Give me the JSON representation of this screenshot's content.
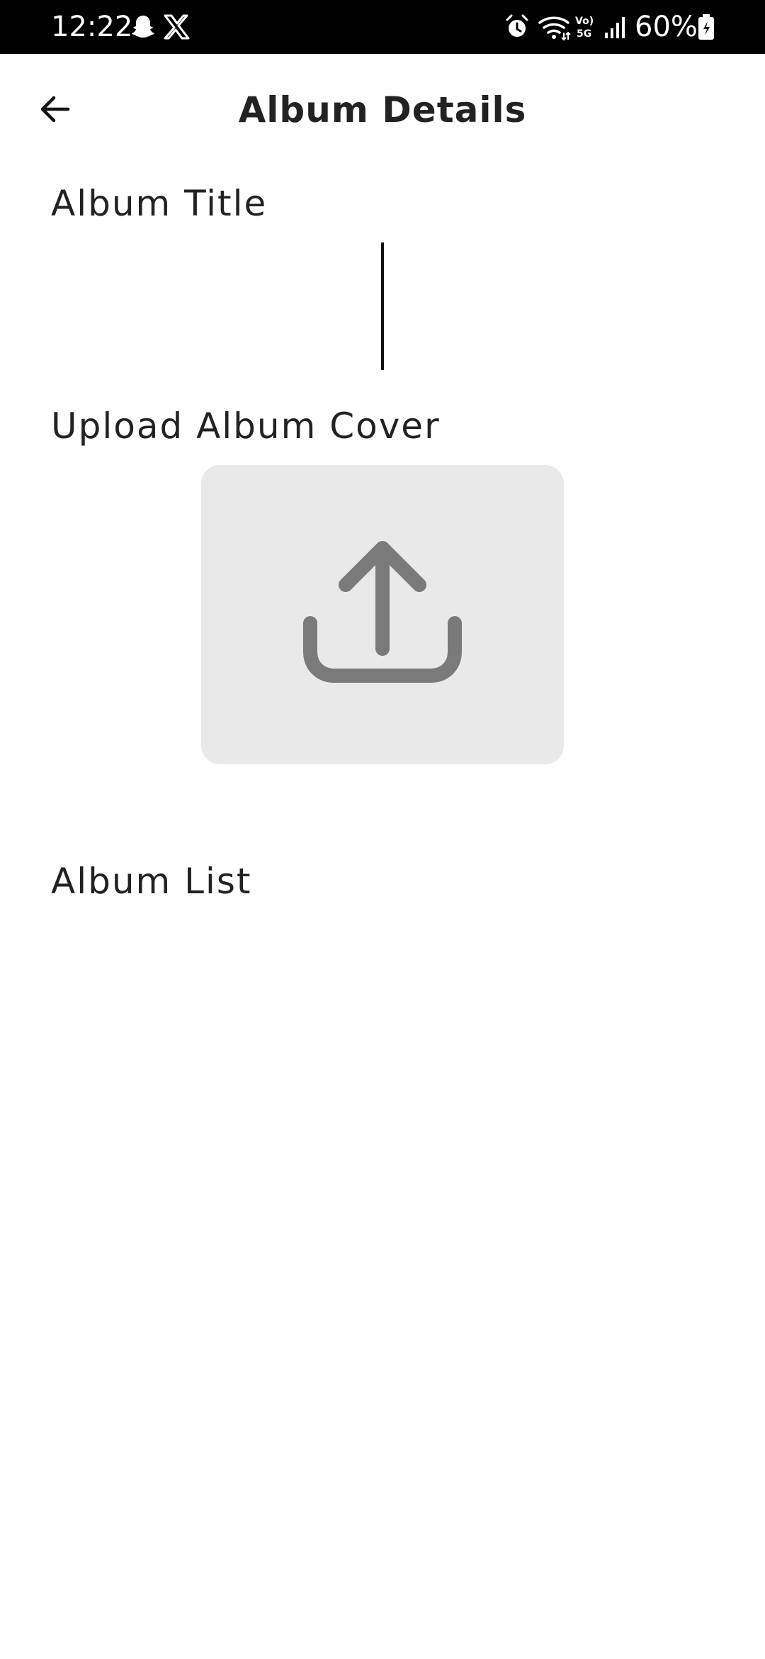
{
  "status_bar": {
    "time": "12:22",
    "battery": "60%",
    "icons": [
      "snapchat-icon",
      "x-icon",
      "alarm-icon",
      "wifi-icon",
      "volte-5g-icon",
      "signal-icon",
      "battery-icon"
    ]
  },
  "header": {
    "title": "Album Details",
    "back_icon": "arrow-left-icon"
  },
  "form": {
    "album_title_label": "Album Title",
    "album_title_value": "",
    "upload_cover_label": "Upload Album Cover",
    "upload_icon": "upload-icon",
    "album_list_label": "Album List"
  },
  "colors": {
    "status_bar_bg": "#000000",
    "text": "#222222",
    "upload_box_bg": "#e9e9e9",
    "upload_icon": "#7a7a7a"
  }
}
